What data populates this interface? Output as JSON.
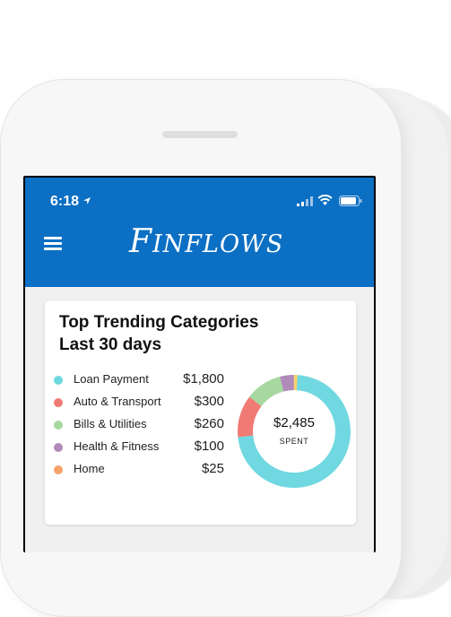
{
  "status_bar": {
    "time": "6:18"
  },
  "app": {
    "brand": "Finflows"
  },
  "card": {
    "title_line1": "Top Trending Categories",
    "title_line2": "Last 30 days",
    "total_amount": "$2,485",
    "total_caption": "SPENT"
  },
  "chart_data": {
    "type": "pie",
    "title": "Top Trending Categories",
    "subtitle": "Last 30 days",
    "categories": [
      "Loan Payment",
      "Auto & Transport",
      "Bills & Utilities",
      "Health & Fitness",
      "Home"
    ],
    "values": [
      1800,
      300,
      260,
      100,
      25
    ],
    "value_labels": [
      "$1,800",
      "$300",
      "$260",
      "$100",
      "$25"
    ],
    "colors": [
      "#6fd8e0",
      "#f07b74",
      "#a7d8a0",
      "#b08ab8",
      "#f5a36b"
    ],
    "center_text": "$2,485",
    "center_caption": "SPENT"
  },
  "colors": {
    "appbar": "#0b6fc4",
    "accent_extra": "#f5d36b"
  },
  "icons": [
    "location-arrow-icon",
    "signal-icon",
    "wifi-icon",
    "battery-icon",
    "menu-icon"
  ]
}
